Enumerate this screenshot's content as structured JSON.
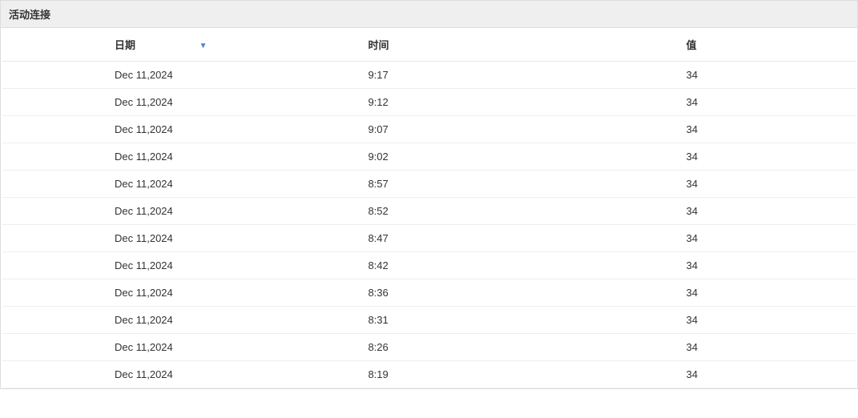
{
  "panel": {
    "title": "活动连接"
  },
  "table": {
    "columns": {
      "date": "日期",
      "time": "时间",
      "value": "值"
    },
    "sort_indicator": "▼",
    "rows": [
      {
        "date": "Dec 11,2024",
        "time": "9:17",
        "value": "34"
      },
      {
        "date": "Dec 11,2024",
        "time": "9:12",
        "value": "34"
      },
      {
        "date": "Dec 11,2024",
        "time": "9:07",
        "value": "34"
      },
      {
        "date": "Dec 11,2024",
        "time": "9:02",
        "value": "34"
      },
      {
        "date": "Dec 11,2024",
        "time": "8:57",
        "value": "34"
      },
      {
        "date": "Dec 11,2024",
        "time": "8:52",
        "value": "34"
      },
      {
        "date": "Dec 11,2024",
        "time": "8:47",
        "value": "34"
      },
      {
        "date": "Dec 11,2024",
        "time": "8:42",
        "value": "34"
      },
      {
        "date": "Dec 11,2024",
        "time": "8:36",
        "value": "34"
      },
      {
        "date": "Dec 11,2024",
        "time": "8:31",
        "value": "34"
      },
      {
        "date": "Dec 11,2024",
        "time": "8:26",
        "value": "34"
      },
      {
        "date": "Dec 11,2024",
        "time": "8:19",
        "value": "34"
      }
    ]
  }
}
